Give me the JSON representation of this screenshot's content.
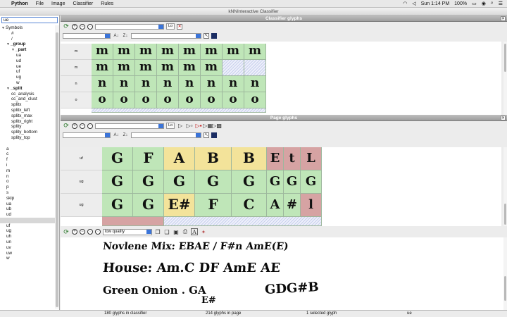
{
  "menubar": {
    "app": "Python",
    "items": [
      "File",
      "Image",
      "Classifier",
      "Rules"
    ],
    "clock": "Sun 1:14 PM",
    "battery": "100%"
  },
  "window_title": "kNNInteractive Classifier",
  "search": {
    "value": "ue"
  },
  "tree": [
    {
      "label": "Symbols",
      "level": 0,
      "toggle": "▼"
    },
    {
      "label": "#",
      "level": 2
    },
    {
      "label": "/",
      "level": 2
    },
    {
      "label": "_group",
      "level": 1,
      "toggle": "▼",
      "bold": true
    },
    {
      "label": "_part",
      "level": 2,
      "toggle": "▼",
      "bold": true
    },
    {
      "label": "ua",
      "level": 3
    },
    {
      "label": "ud",
      "level": 3
    },
    {
      "label": "ue",
      "level": 3
    },
    {
      "label": "uf",
      "level": 3
    },
    {
      "label": "ug",
      "level": 3
    },
    {
      "label": "w",
      "level": 3
    },
    {
      "label": "_split",
      "level": 1,
      "toggle": "▼",
      "bold": true
    },
    {
      "label": "cc_analysis",
      "level": 2
    },
    {
      "label": "cc_and_clust",
      "level": 2
    },
    {
      "label": "splitx",
      "level": 2
    },
    {
      "label": "splitx_left",
      "level": 2
    },
    {
      "label": "splitx_max",
      "level": 2
    },
    {
      "label": "splitx_right",
      "level": 2
    },
    {
      "label": "splity",
      "level": 2
    },
    {
      "label": "splity_bottom",
      "level": 2
    },
    {
      "label": "splity_top",
      "level": 2
    },
    {
      "label": "",
      "level": 2
    },
    {
      "label": "a",
      "level": 1
    },
    {
      "label": "c",
      "level": 1
    },
    {
      "label": "f",
      "level": 1
    },
    {
      "label": "i",
      "level": 1
    },
    {
      "label": "m",
      "level": 1
    },
    {
      "label": "n",
      "level": 1
    },
    {
      "label": "o",
      "level": 1
    },
    {
      "label": "p",
      "level": 1
    },
    {
      "label": "s",
      "level": 1
    },
    {
      "label": "skip",
      "level": 1
    },
    {
      "label": "ua",
      "level": 1
    },
    {
      "label": "ub",
      "level": 1
    },
    {
      "label": "ud",
      "level": 1
    },
    {
      "label": "",
      "level": 1,
      "selected": true
    },
    {
      "label": "uf",
      "level": 1
    },
    {
      "label": "ug",
      "level": 1
    },
    {
      "label": "uh",
      "level": 1
    },
    {
      "label": "un",
      "level": 1
    },
    {
      "label": "uv",
      "level": 1
    },
    {
      "label": "uw",
      "level": 1
    },
    {
      "label": "w",
      "level": 1
    }
  ],
  "classifier_pane": {
    "title": "Classifier glyphs",
    "lo_label": "Lo",
    "rows": [
      {
        "label": "m",
        "glyphs": [
          "m",
          "m",
          "m",
          "m",
          "m",
          "m",
          "m",
          "m"
        ],
        "hatch_from": 8
      },
      {
        "label": "m",
        "glyphs": [
          "m",
          "m",
          "m",
          "m",
          "m",
          "m"
        ],
        "hatch_from": 6
      },
      {
        "label": "n",
        "glyphs": [
          "n",
          "n",
          "n",
          "n",
          "n",
          "n",
          "n",
          "n"
        ],
        "hatch_from": 8
      },
      {
        "label": "o",
        "glyphs": [
          "o",
          "o",
          "o",
          "o",
          "o",
          "o",
          "o",
          "o"
        ],
        "hatch_from": 8
      }
    ]
  },
  "page_pane": {
    "title": "Page glyphs",
    "lo_label": "Lo",
    "rows": [
      {
        "label": "uf",
        "cells": [
          {
            "t": "G",
            "c": "g"
          },
          {
            "t": "F",
            "c": "g"
          },
          {
            "t": "A",
            "c": "y"
          },
          {
            "t": "B",
            "c": "y"
          },
          {
            "t": "B",
            "c": "y"
          },
          {
            "t": "E",
            "c": "r"
          },
          {
            "t": "t",
            "c": "r"
          },
          {
            "t": "L",
            "c": "r"
          }
        ]
      },
      {
        "label": "ug",
        "cells": [
          {
            "t": "G",
            "c": "g"
          },
          {
            "t": "G",
            "c": "g"
          },
          {
            "t": "G",
            "c": "g"
          },
          {
            "t": "G",
            "c": "g"
          },
          {
            "t": "G",
            "c": "g"
          },
          {
            "t": "G",
            "c": "g"
          },
          {
            "t": "G",
            "c": "g"
          },
          {
            "t": "G",
            "c": "g"
          }
        ]
      },
      {
        "label": "ug",
        "cells": [
          {
            "t": "G",
            "c": "g"
          },
          {
            "t": "G",
            "c": "g"
          },
          {
            "t": "E#",
            "c": "y"
          },
          {
            "t": "F",
            "c": "g"
          },
          {
            "t": "C",
            "c": "g"
          },
          {
            "t": "A",
            "c": "g"
          },
          {
            "t": "#",
            "c": "g"
          },
          {
            "t": "l",
            "c": "r"
          }
        ]
      }
    ]
  },
  "image_pane": {
    "quality_value": "low quality",
    "lines": [
      "Novlene Mix: EBAE / F#n AmE(E)",
      "House: Am.C DF AmE AE",
      "Green Onion . GA",
      "GDG#B",
      "E#"
    ]
  },
  "status": {
    "classifier_count": "180 glyphs in classifier",
    "page_count": "214 glyphs in page",
    "selected": "1 selected glyph",
    "current": "ue"
  }
}
